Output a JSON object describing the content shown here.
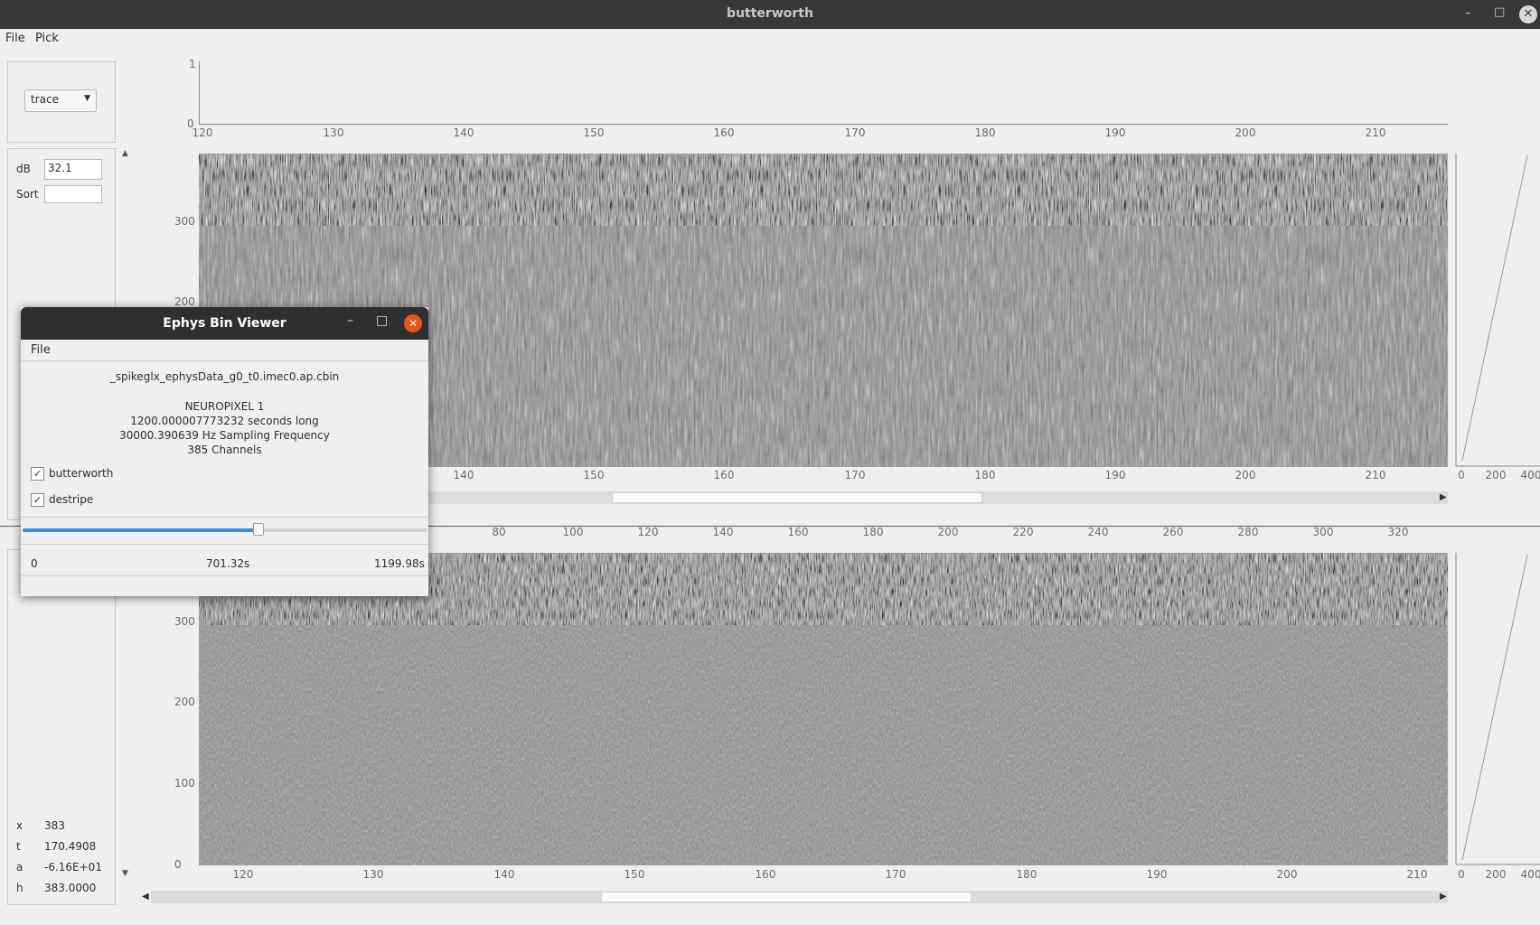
{
  "window": {
    "title": "butterworth"
  },
  "menu": {
    "file": "File",
    "pick": "Pick"
  },
  "sidebar_top": {
    "view_select": "trace",
    "db_label": "dB",
    "db_value": "32.1",
    "sort_label": "Sort",
    "sort_value": ""
  },
  "top_axis": {
    "y_ticks": [
      "1",
      "0"
    ],
    "x_ticks": [
      "120",
      "130",
      "140",
      "150",
      "160",
      "170",
      "180",
      "190",
      "200",
      "210"
    ]
  },
  "plot1": {
    "y_ticks": [
      "300",
      "200"
    ],
    "x_ticks": [
      "140",
      "150",
      "160",
      "170",
      "180",
      "190",
      "200",
      "210"
    ],
    "right_ticks": [
      "0",
      "200",
      "400"
    ]
  },
  "mid_axis": {
    "x_ticks": [
      "80",
      "100",
      "120",
      "140",
      "160",
      "180",
      "200",
      "220",
      "240",
      "260",
      "280",
      "300",
      "320"
    ]
  },
  "plot2": {
    "y_ticks": [
      "300",
      "200",
      "100",
      "0"
    ],
    "x_ticks": [
      "120",
      "130",
      "140",
      "150",
      "160",
      "170",
      "180",
      "190",
      "200",
      "210"
    ],
    "right_ticks": [
      "0",
      "200",
      "400"
    ]
  },
  "cursor_info": {
    "x_label": "x",
    "x_value": "383",
    "t_label": "t",
    "t_value": "170.4908",
    "a_label": "a",
    "a_value": "-6.16E+01",
    "h_label": "h",
    "h_value": "383.0000"
  },
  "dialog": {
    "title": "Ephys Bin Viewer",
    "menu_file": "File",
    "filename": "_spikeglx_ephysData_g0_t0.imec0.ap.cbin",
    "probe": "NEUROPIXEL 1",
    "duration": "1200.000007773232 seconds long",
    "sampling": "30000.390639 Hz Sampling Frequency",
    "channels": "385 Channels",
    "butterworth_label": "butterworth",
    "butterworth_checked": true,
    "destripe_label": "destripe",
    "destripe_checked": true,
    "slider_fraction": 0.5844,
    "time_start": "0",
    "time_current": "701.32s",
    "time_end": "1199.98s"
  }
}
